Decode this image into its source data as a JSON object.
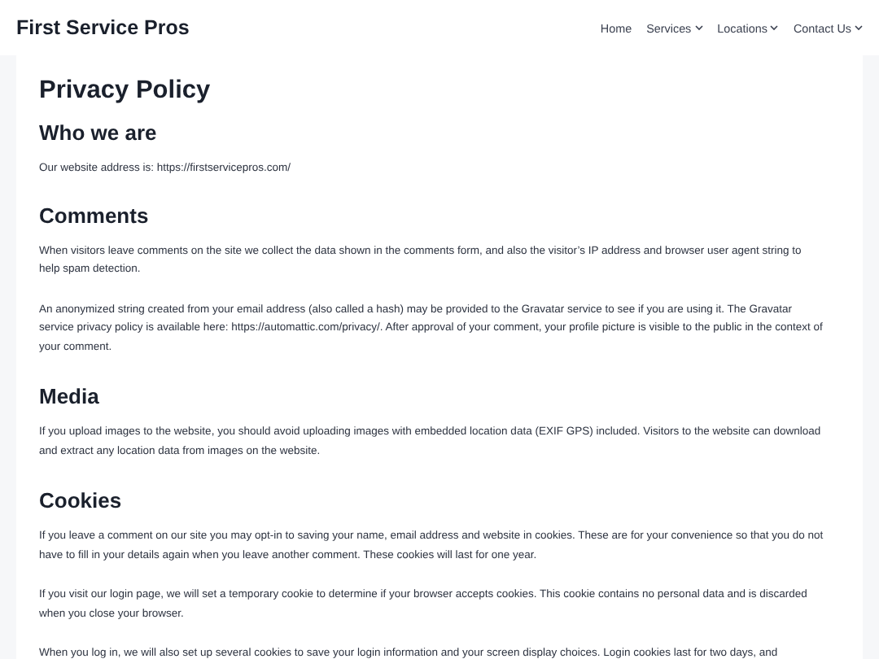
{
  "header": {
    "site_title": "First Service Pros",
    "nav": [
      {
        "label": "Home",
        "has_dropdown": false
      },
      {
        "label": "Services",
        "has_dropdown": true
      },
      {
        "label": "Locations",
        "has_dropdown": true
      },
      {
        "label": "Contact Us",
        "has_dropdown": true
      }
    ]
  },
  "page": {
    "title": "Privacy Policy",
    "sections": [
      {
        "heading": "Who we are",
        "paragraphs": [
          "Our website address is: https://firstservicepros.com/"
        ]
      },
      {
        "heading": "Comments",
        "paragraphs": [
          "When visitors leave comments on the site we collect the data shown in the comments form, and also the visitor’s IP address and browser user agent string to help spam detection.",
          "An anonymized string created from your email address (also called a hash) may be provided to the Gravatar service to see if you are using it. The Gravatar service privacy policy is available here: https://automattic.com/privacy/. After approval of your comment, your profile picture is visible to the public in the context of your comment."
        ]
      },
      {
        "heading": "Media",
        "paragraphs": [
          "If you upload images to the website, you should avoid uploading images with embedded location data (EXIF GPS) included. Visitors to the website can download and extract any location data from images on the website."
        ]
      },
      {
        "heading": "Cookies",
        "paragraphs": [
          "If you leave a comment on our site you may opt-in to saving your name, email address and website in cookies. These are for your convenience so that you do not have to fill in your details again when you leave another comment. These cookies will last for one year.",
          "If you visit our login page, we will set a temporary cookie to determine if your browser accepts cookies. This cookie contains no personal data and is discarded when you close your browser.",
          "When you log in, we will also set up several cookies to save your login information and your screen display choices. Login cookies last for two days, and"
        ]
      }
    ]
  }
}
